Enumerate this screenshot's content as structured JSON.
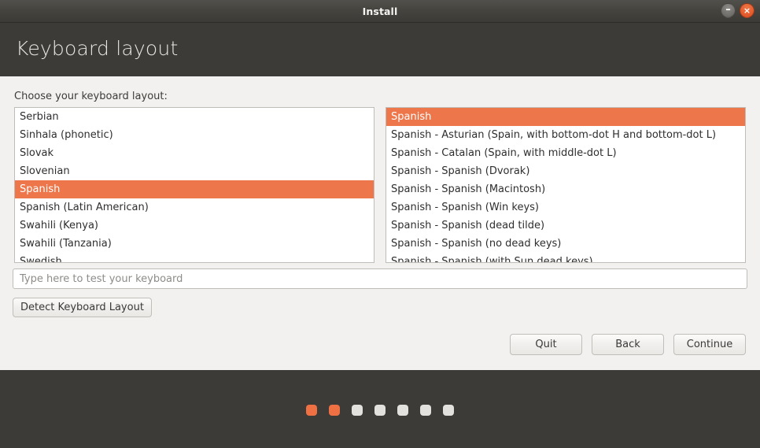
{
  "window": {
    "title": "Install",
    "minimize_label": "–",
    "close_label": "×",
    "minimize_icon": "minimize-icon",
    "close_icon": "close-icon"
  },
  "header": {
    "page_title": "Keyboard layout"
  },
  "main": {
    "prompt": "Choose your keyboard layout:",
    "layout_list": [
      {
        "label": "Serbian",
        "selected": false
      },
      {
        "label": "Sinhala (phonetic)",
        "selected": false
      },
      {
        "label": "Slovak",
        "selected": false
      },
      {
        "label": "Slovenian",
        "selected": false
      },
      {
        "label": "Spanish",
        "selected": true
      },
      {
        "label": "Spanish (Latin American)",
        "selected": false
      },
      {
        "label": "Swahili (Kenya)",
        "selected": false
      },
      {
        "label": "Swahili (Tanzania)",
        "selected": false
      },
      {
        "label": "Swedish",
        "selected": false
      }
    ],
    "variant_list": [
      {
        "label": "Spanish",
        "selected": true
      },
      {
        "label": "Spanish - Asturian (Spain, with bottom-dot H and bottom-dot L)",
        "selected": false
      },
      {
        "label": "Spanish - Catalan (Spain, with middle-dot L)",
        "selected": false
      },
      {
        "label": "Spanish - Spanish (Dvorak)",
        "selected": false
      },
      {
        "label": "Spanish - Spanish (Macintosh)",
        "selected": false
      },
      {
        "label": "Spanish - Spanish (Win keys)",
        "selected": false
      },
      {
        "label": "Spanish - Spanish (dead tilde)",
        "selected": false
      },
      {
        "label": "Spanish - Spanish (no dead keys)",
        "selected": false
      },
      {
        "label": "Spanish - Spanish (with Sun dead keys)",
        "selected": false
      }
    ],
    "test_input": {
      "value": "",
      "placeholder": "Type here to test your keyboard"
    },
    "detect_button": "Detect Keyboard Layout"
  },
  "nav": {
    "quit": "Quit",
    "back": "Back",
    "continue": "Continue"
  },
  "footer": {
    "steps_total": 7,
    "steps_active": 2
  },
  "colors": {
    "accent": "#ed764a",
    "header_bg": "#3c3b37",
    "content_bg": "#f2f1f0",
    "close_button": "#e2572a"
  }
}
